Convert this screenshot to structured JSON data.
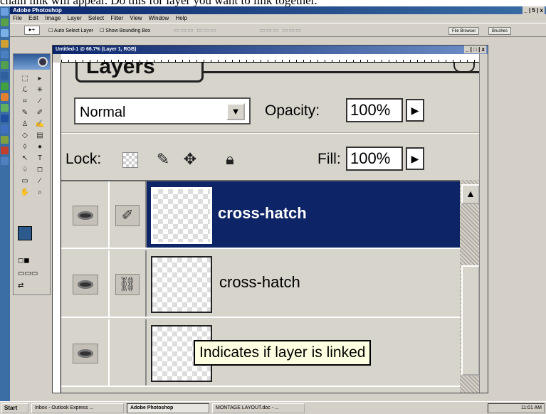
{
  "caption": "chain link will appear. Do this for layer you want to link together.",
  "app": {
    "title": "Adobe Photoshop",
    "window_controls": "_ | 5 | x",
    "menu": [
      "File",
      "Edit",
      "Image",
      "Layer",
      "Select",
      "Filter",
      "View",
      "Window",
      "Help"
    ]
  },
  "options_bar": {
    "auto_select": "Auto Select Layer",
    "show_bounding": "Show Bounding Box",
    "well_tabs": [
      "File Browser",
      "Brushes"
    ]
  },
  "document": {
    "title": "Untitled-1 @ 66.7% (Layer 1, RGB)",
    "controls": "_ | □ | x"
  },
  "layers_palette": {
    "tab_label": "Layers",
    "blend_mode": "Normal",
    "opacity_label": "Opacity:",
    "opacity_value": "100%",
    "lock_label": "Lock:",
    "fill_label": "Fill:",
    "fill_value": "100%",
    "layers": [
      {
        "name": "cross-hatch",
        "selected": true,
        "link_icon": "brush-icon"
      },
      {
        "name": "cross-hatch",
        "selected": false,
        "link_icon": "chain-link-icon"
      },
      {
        "name": "",
        "selected": false,
        "link_icon": ""
      }
    ],
    "tooltip": "Indicates if layer is linked"
  },
  "taskbar": {
    "start": "Start",
    "tasks": [
      "Inbox - Outlook Express ...",
      "Adobe Photoshop",
      "MONTAGE LAYOUT.doc - ..."
    ],
    "active_task": "Adobe Photoshop",
    "clock": "11:01 AM"
  },
  "colors": {
    "selection_blue": "#0d2466",
    "foreground_swatch": "#2c5a8c",
    "tooltip_bg": "#ffffe1"
  }
}
